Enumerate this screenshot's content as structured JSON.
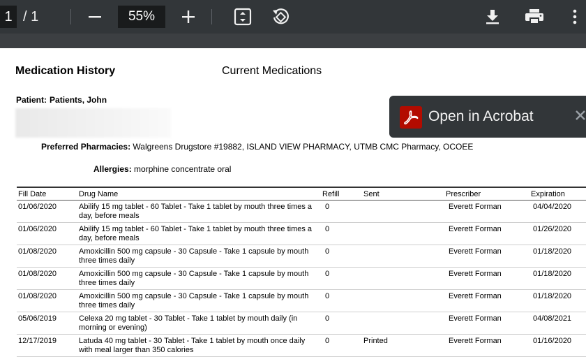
{
  "toolbar": {
    "page_current": "1",
    "page_total": "/ 1",
    "zoom": "55%",
    "icons": [
      "minus-icon",
      "plus-icon",
      "fit-page-icon",
      "rotate-icon",
      "download-icon",
      "print-icon",
      "more-vert-icon"
    ]
  },
  "document": {
    "title": "Medication History",
    "subtitle": "Current Medications",
    "patient_label": "Patient:",
    "patient_name": "Patients, John",
    "pharmacies_label": "Preferred Pharmacies:",
    "pharmacies": "Walgreens Drugstore #19882, ISLAND VIEW PHARMACY, UTMB CMC Pharmacy, OCOEE",
    "allergies_label": "Allergies:",
    "allergies": "morphine concentrate oral",
    "table": {
      "headers": {
        "fill_date": "Fill Date",
        "drug_name": "Drug Name",
        "refill": "Refill",
        "sent": "Sent",
        "prescriber": "Prescriber",
        "expiration": "Expiration"
      },
      "rows": [
        {
          "fill_date": "01/06/2020",
          "drug": "Abilify 15 mg tablet -  60 Tablet - Take 1 tablet by mouth three times a day, before meals",
          "refill": "0",
          "sent": "",
          "prescriber": "Everett Forman",
          "expiration": "04/04/2020"
        },
        {
          "fill_date": "01/06/2020",
          "drug": "Abilify 15 mg tablet -  60 Tablet - Take 1 tablet by mouth three times a day, before meals",
          "refill": "0",
          "sent": "",
          "prescriber": "Everett Forman",
          "expiration": "01/26/2020"
        },
        {
          "fill_date": "01/08/2020",
          "drug": "Amoxicillin 500 mg capsule -  30 Capsule - Take 1 capsule by mouth three times daily",
          "refill": "0",
          "sent": "",
          "prescriber": "Everett Forman",
          "expiration": "01/18/2020"
        },
        {
          "fill_date": "01/08/2020",
          "drug": "Amoxicillin 500 mg capsule -  30 Capsule - Take 1 capsule by mouth three times daily",
          "refill": "0",
          "sent": "",
          "prescriber": "Everett Forman",
          "expiration": "01/18/2020"
        },
        {
          "fill_date": "01/08/2020",
          "drug": "Amoxicillin 500 mg capsule -  30 Capsule - Take 1 capsule by mouth three times daily",
          "refill": "0",
          "sent": "",
          "prescriber": "Everett Forman",
          "expiration": "01/18/2020"
        },
        {
          "fill_date": "05/06/2019",
          "drug": "Celexa 20 mg tablet - 30 Tablet - Take 1 tablet by mouth daily (in morning or evening)",
          "refill": "0",
          "sent": "",
          "prescriber": "Everett Forman",
          "expiration": "04/08/2021"
        },
        {
          "fill_date": "12/17/2019",
          "drug": "Latuda 40 mg tablet -  30 Tablet - Take 1 tablet by mouth once daily with meal larger than 350 calories",
          "refill": "0",
          "sent": "Printed",
          "prescriber": "Everett Forman",
          "expiration": "01/16/2020"
        }
      ]
    }
  },
  "toast": {
    "label": "Open in Acrobat",
    "logo_color": "#b30b00"
  },
  "colors": {
    "toolbar_bg": "#323639",
    "field_bg": "#191b1c"
  }
}
